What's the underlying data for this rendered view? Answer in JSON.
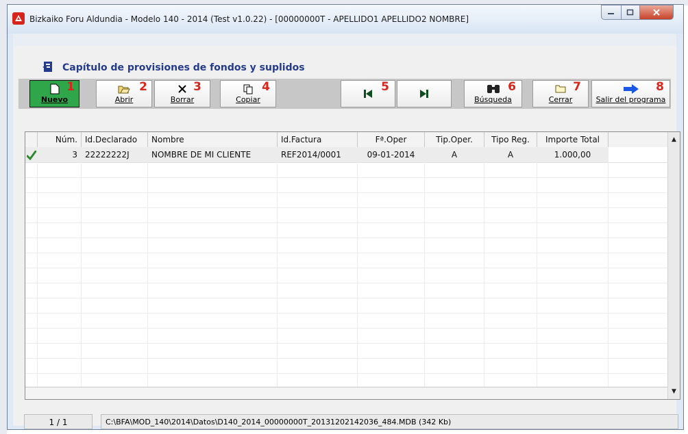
{
  "window": {
    "title": "Bizkaiko Foru Aldundia - Modelo 140 - 2014 (Test v1.0.22) - [00000000T - APELLIDO1 APELLIDO2 NOMBRE]"
  },
  "header": {
    "title": "Capítulo de provisiones de fondos y suplidos"
  },
  "toolbar": {
    "nuevo": {
      "label": "Nuevo",
      "num": "1"
    },
    "abrir": {
      "label": "Abrir",
      "num": "2"
    },
    "borrar": {
      "label": "Borrar",
      "num": "3"
    },
    "copiar": {
      "label": "Copiar",
      "num": "4"
    },
    "nav": {
      "num": "5"
    },
    "busqueda": {
      "label": "Búsqueda",
      "num": "6"
    },
    "cerrar": {
      "label": "Cerrar",
      "num": "7"
    },
    "salir": {
      "label": "Salir del programa",
      "num": "8"
    }
  },
  "grid": {
    "columns": [
      "Núm.",
      "Id.Declarado",
      "Nombre",
      "Id.Factura",
      "Fª.Oper",
      "Tip.Oper.",
      "Tipo Reg.",
      "Importe Total"
    ],
    "rows": [
      {
        "status_icon": "check-icon",
        "num": "3",
        "id_declarado": "22222222J",
        "nombre": "NOMBRE DE MI CLIENTE",
        "id_factura": "REF2014/0001",
        "fecha_oper": "09-01-2014",
        "tip_oper": "A",
        "tipo_reg": "A",
        "importe_total": "1.000,00"
      }
    ]
  },
  "status": {
    "position": "1 / 1",
    "path": "C:\\BFA\\MOD_140\\2014\\Datos\\D140_2014_00000000T_20131202142036_484.MDB (342 Kb)"
  },
  "colors": {
    "accent_title": "#253b8c",
    "new_button": "#2fa64a",
    "number_markers": "#d7261b"
  }
}
